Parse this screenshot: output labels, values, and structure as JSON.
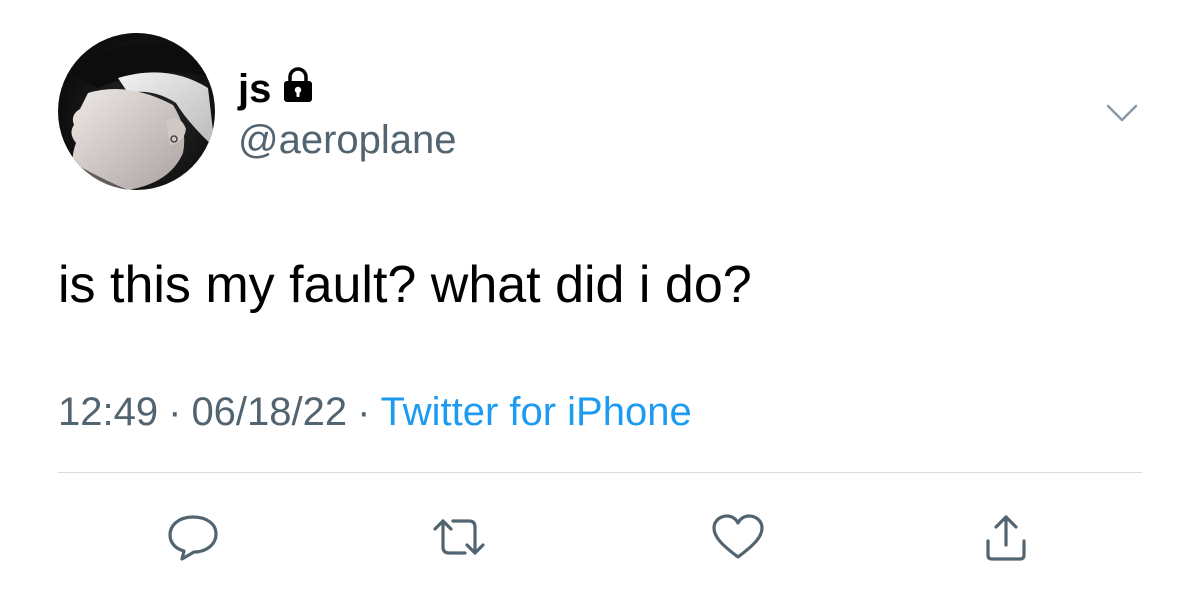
{
  "tweet": {
    "display_name": "js",
    "handle": "@aeroplane",
    "text": "is this my fault? what did i do?",
    "time": "12:49",
    "separator": "·",
    "date": "06/18/22",
    "source": "Twitter for iPhone",
    "protected_icon": "lock-icon",
    "more_icon": "chevron-down-icon"
  },
  "actions": [
    {
      "name": "reply",
      "icon": "reply-icon"
    },
    {
      "name": "retweet",
      "icon": "retweet-icon"
    },
    {
      "name": "like",
      "icon": "heart-icon"
    },
    {
      "name": "share",
      "icon": "share-icon"
    }
  ],
  "colors": {
    "text": "#000000",
    "secondary": "#536471",
    "link": "#1d9bf0",
    "divider": "#d6dbdf"
  }
}
